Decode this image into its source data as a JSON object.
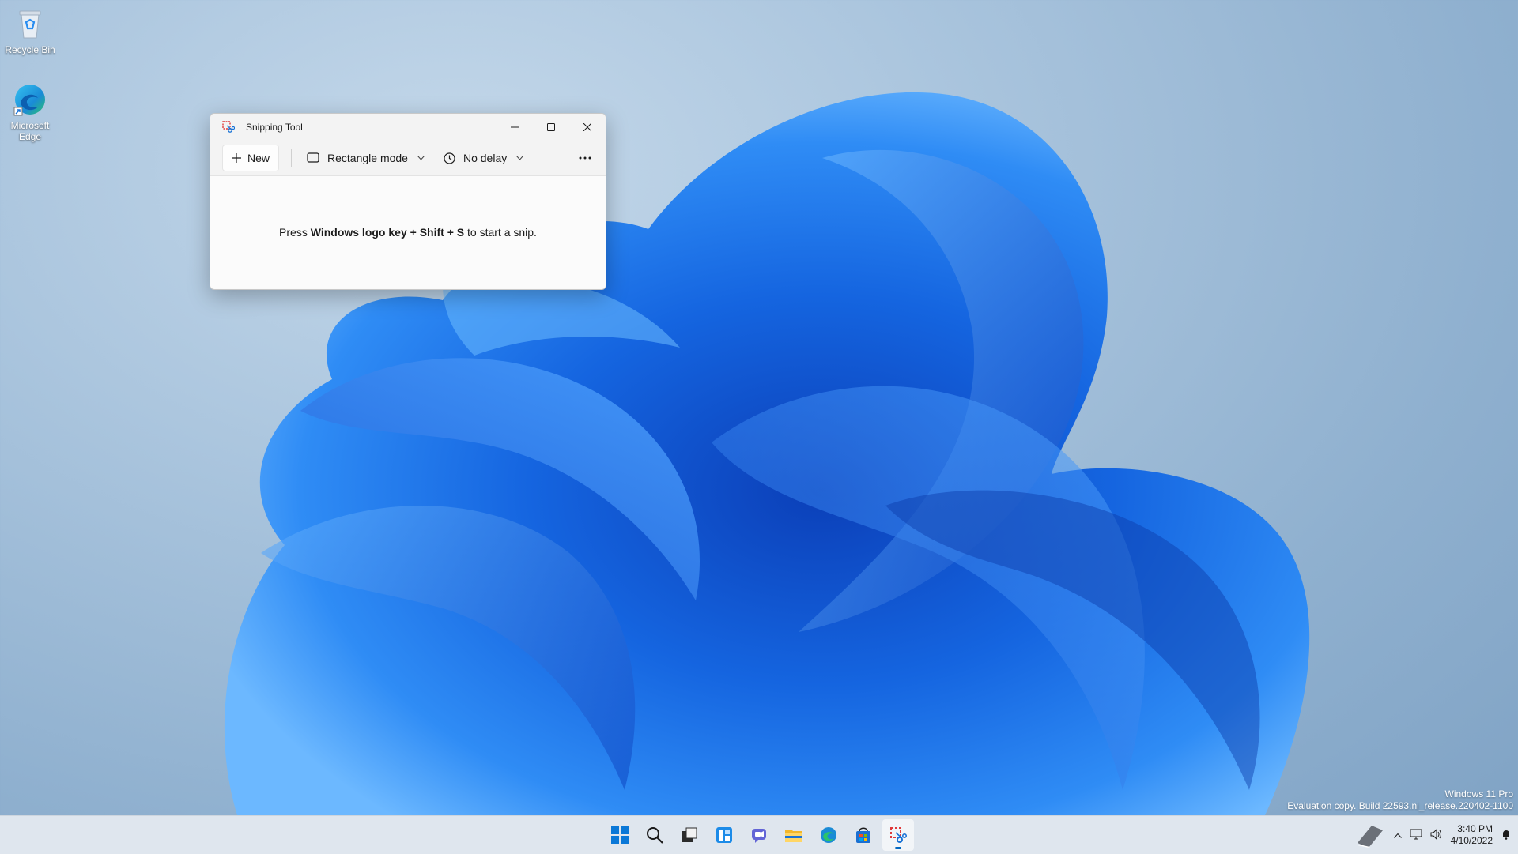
{
  "desktop": {
    "icons": [
      {
        "label": "Recycle Bin",
        "icon": "recycle-bin-icon"
      },
      {
        "label": "Microsoft Edge",
        "icon": "edge-icon"
      }
    ],
    "watermark": {
      "line1": "Windows 11 Pro",
      "line2": "Evaluation copy. Build 22593.ni_release.220402-1100"
    }
  },
  "window": {
    "title": "Snipping Tool",
    "toolbar": {
      "new_label": "New",
      "mode_label": "Rectangle mode",
      "delay_label": "No delay"
    },
    "message": {
      "prefix": "Press ",
      "key1": "Windows logo key",
      "plus1": " + ",
      "key2": "Shift",
      "plus2": " + ",
      "key3": "S",
      "suffix": " to start a snip."
    }
  },
  "taskbar": {
    "apps": [
      "start-icon",
      "search-icon",
      "task-view-icon",
      "widgets-icon",
      "chat-icon",
      "file-explorer-icon",
      "edge-icon",
      "store-icon",
      "snipping-tool-icon"
    ],
    "active_app": "snipping-tool-icon",
    "tray": {
      "time": "3:40 PM",
      "date": "4/10/2022"
    }
  },
  "colors": {
    "accent": "#0067c0",
    "bloom": "#1a6be0"
  }
}
